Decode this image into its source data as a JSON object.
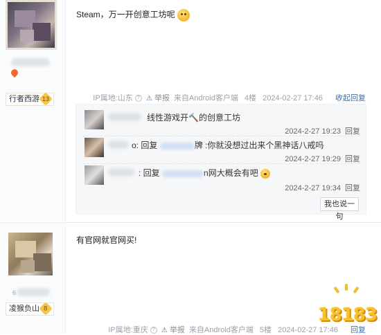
{
  "posts": [
    {
      "level_title": "行者西游",
      "level": "13",
      "content": "Steam，万一开创意工坊呢",
      "meta": {
        "ip": "IP属地:山东",
        "report": "举报",
        "source": "来自Android客户端",
        "floor": "4楼",
        "time": "2024-02-27 17:46",
        "collapse": "收起回复"
      },
      "replies": [
        {
          "text": "线性游戏开🔨的创意工坊",
          "time": "2024-2-27 19:23",
          "action": "回复"
        },
        {
          "prefix": "o: 回复",
          "text": "牌 :你就没想过出来个黑神话八戒吗",
          "time": "2024-2-27 19:29",
          "action": "回复"
        },
        {
          "prefix": ": 回复",
          "text": "n网大概会有吧",
          "time": "2024-2-27 19:34",
          "action": "回复"
        }
      ],
      "say_button": "我也说一句"
    },
    {
      "user_id_partial": "6",
      "level_title": "凌猴负山",
      "level": "8",
      "content": "有官网就官网买!",
      "meta": {
        "ip": "IP属地:重庆",
        "report": "举报",
        "source": "来自Android客户端",
        "floor": "5楼",
        "time": "2024-02-27 17:46",
        "reply": "回复"
      }
    }
  ],
  "watermark": "18183",
  "colors": {
    "link": "#3a6fb5",
    "badge": "#f3c74b",
    "watermark": "#f7c232"
  }
}
